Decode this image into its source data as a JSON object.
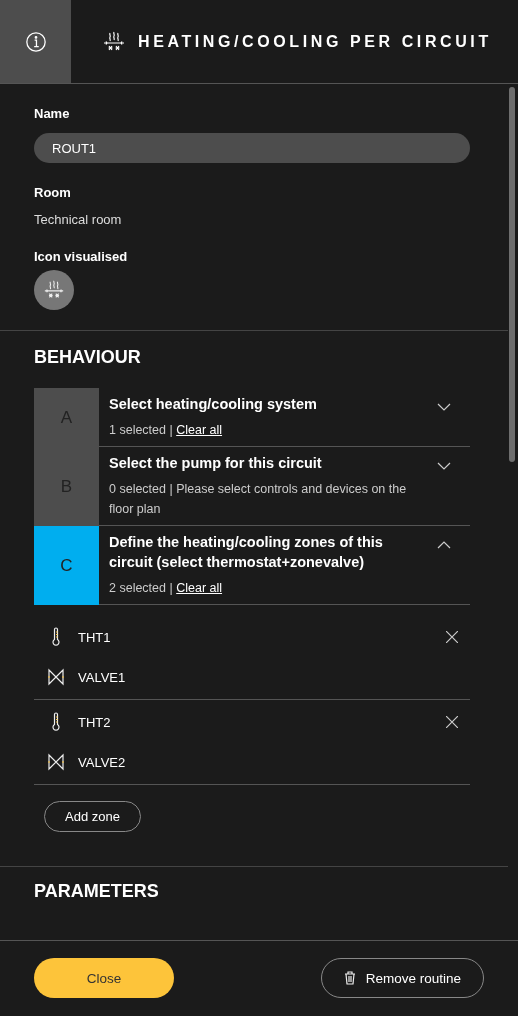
{
  "header": {
    "title": "HEATING/COOLING PER CIRCUIT"
  },
  "fields": [
    {
      "kind": "input",
      "label": "Name",
      "value": "ROUT1"
    },
    {
      "kind": "text",
      "label": "Room",
      "value": "Technical room"
    },
    {
      "kind": "icon",
      "label": "Icon visualised"
    }
  ],
  "behaviour": {
    "title": "BEHAVIOUR",
    "steps": [
      {
        "letter": "A",
        "title": "Select heating/cooling system",
        "status": "1 selected | ",
        "link": "Clear all",
        "expanded": false
      },
      {
        "letter": "B",
        "title": "Select the pump for this circuit",
        "status": "0 selected | Please select controls and devices on the floor plan",
        "expanded": false
      },
      {
        "letter": "C",
        "title": "Define the heating/cooling zones of this circuit (select thermostat+zonevalve)",
        "status": "2 selected | ",
        "link": "Clear all",
        "expanded": true
      }
    ],
    "zones": [
      {
        "items": [
          {
            "kind": "thermostat",
            "name": "THT1"
          },
          {
            "kind": "valve",
            "name": "VALVE1"
          }
        ]
      },
      {
        "items": [
          {
            "kind": "thermostat",
            "name": "THT2"
          },
          {
            "kind": "valve",
            "name": "VALVE2"
          }
        ]
      }
    ],
    "add_button": "Add zone"
  },
  "parameters": {
    "title": "PARAMETERS"
  },
  "footer": {
    "close": "Close",
    "remove": "Remove routine"
  }
}
